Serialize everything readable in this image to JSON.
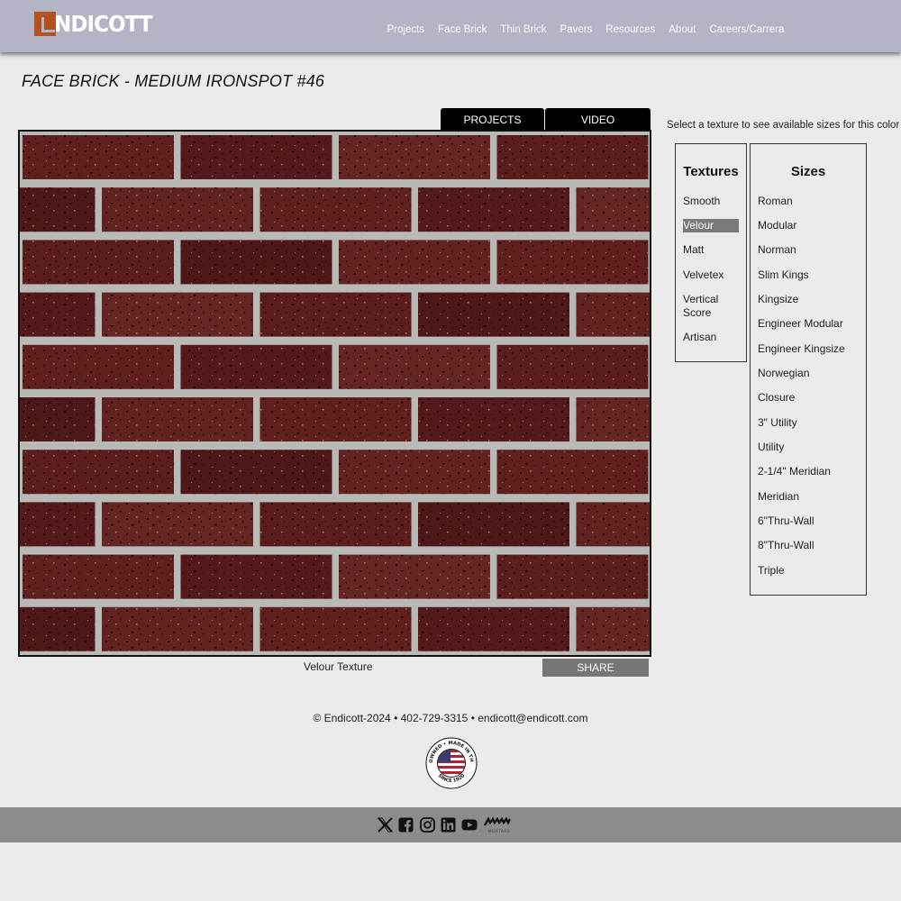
{
  "brand": {
    "name": "NDICOTT"
  },
  "nav": {
    "items": [
      "Projects",
      "Face Brick",
      "Thin Brick",
      "Pavers",
      "Resources",
      "About",
      "Careers/Carrera"
    ]
  },
  "page": {
    "title": "FACE BRICK - MEDIUM IRONSPOT #46"
  },
  "tabs": {
    "projects": "PROJECTS",
    "video": "VIDEO"
  },
  "viewer": {
    "caption": "Velour Texture",
    "share_label": "SHARE"
  },
  "selector": {
    "hint": "Select a texture to see available sizes for this color",
    "textures_title": "Textures",
    "textures": [
      "Smooth",
      "Velour",
      "Matt",
      "Velvetex",
      "Vertical Score",
      "Artisan"
    ],
    "selected_texture": "Velour",
    "sizes_title": "Sizes",
    "sizes": [
      "Roman",
      "Modular",
      "Norman",
      "Slim Kings",
      "Kingsize",
      "Engineer Modular",
      "Engineer Kingsize",
      "Norwegian",
      "Closure",
      "3\" Utility",
      "Utility",
      "2-1/4\" Meridian",
      "Meridian",
      "6\"Thru-Wall",
      "8\"Thru-Wall",
      "Triple"
    ]
  },
  "footer": {
    "copyright": "© Endicott-2024",
    "phone": "402-729-3315",
    "email": "endicott@endicott.com",
    "separator": "•",
    "badge_top": "FAMILY OWNED • MADE IN THE U.S.A.",
    "badge_bottom": "SINCE 1920"
  },
  "social": {
    "icons": [
      "x-icon",
      "facebook-icon",
      "instagram-icon",
      "linkedin-icon",
      "youtube-icon",
      "mortars-icon"
    ],
    "mortars_label": "MORTARS"
  },
  "colors": {
    "header": "#b3b4c6",
    "logo_accent": "#b4521f",
    "brick": "#5e1f1c",
    "mortar": "#b8b8b6",
    "social_bar": "#8c8c8c"
  }
}
